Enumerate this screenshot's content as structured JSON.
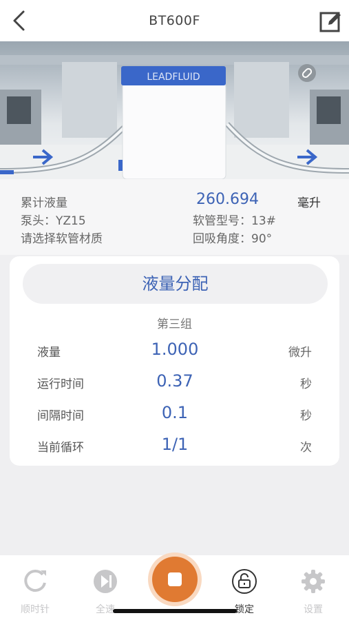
{
  "header": {
    "title": "BT600F",
    "back_icon": "chevron-left-icon",
    "edit_icon": "edit-icon"
  },
  "hero": {
    "brand": "LEADFLUID",
    "link_icon": "link-icon",
    "accent": "#3d63b5"
  },
  "info": {
    "cumulative_label": "累计液量",
    "cumulative_value": "260.694",
    "cumulative_unit": "毫升",
    "pump_head": "泵头：YZ15",
    "tube_model": "软管型号：13#",
    "tube_material": "请选择软管材质",
    "suckback_angle": "回吸角度：90°"
  },
  "card": {
    "mode_button": "液量分配",
    "group_title": "第三组",
    "rows": [
      {
        "label": "液量",
        "value": "1.000",
        "unit": "微升"
      },
      {
        "label": "运行时间",
        "value": "0.37",
        "unit": "秒"
      },
      {
        "label": "间隔时间",
        "value": "0.1",
        "unit": "秒"
      },
      {
        "label": "当前循环",
        "value": "1/1",
        "unit": "次"
      }
    ]
  },
  "bottom_nav": {
    "clockwise": "顺时针",
    "full_speed": "全速",
    "lock": "锁定",
    "settings": "设置",
    "stop_color": "#e07a32"
  }
}
